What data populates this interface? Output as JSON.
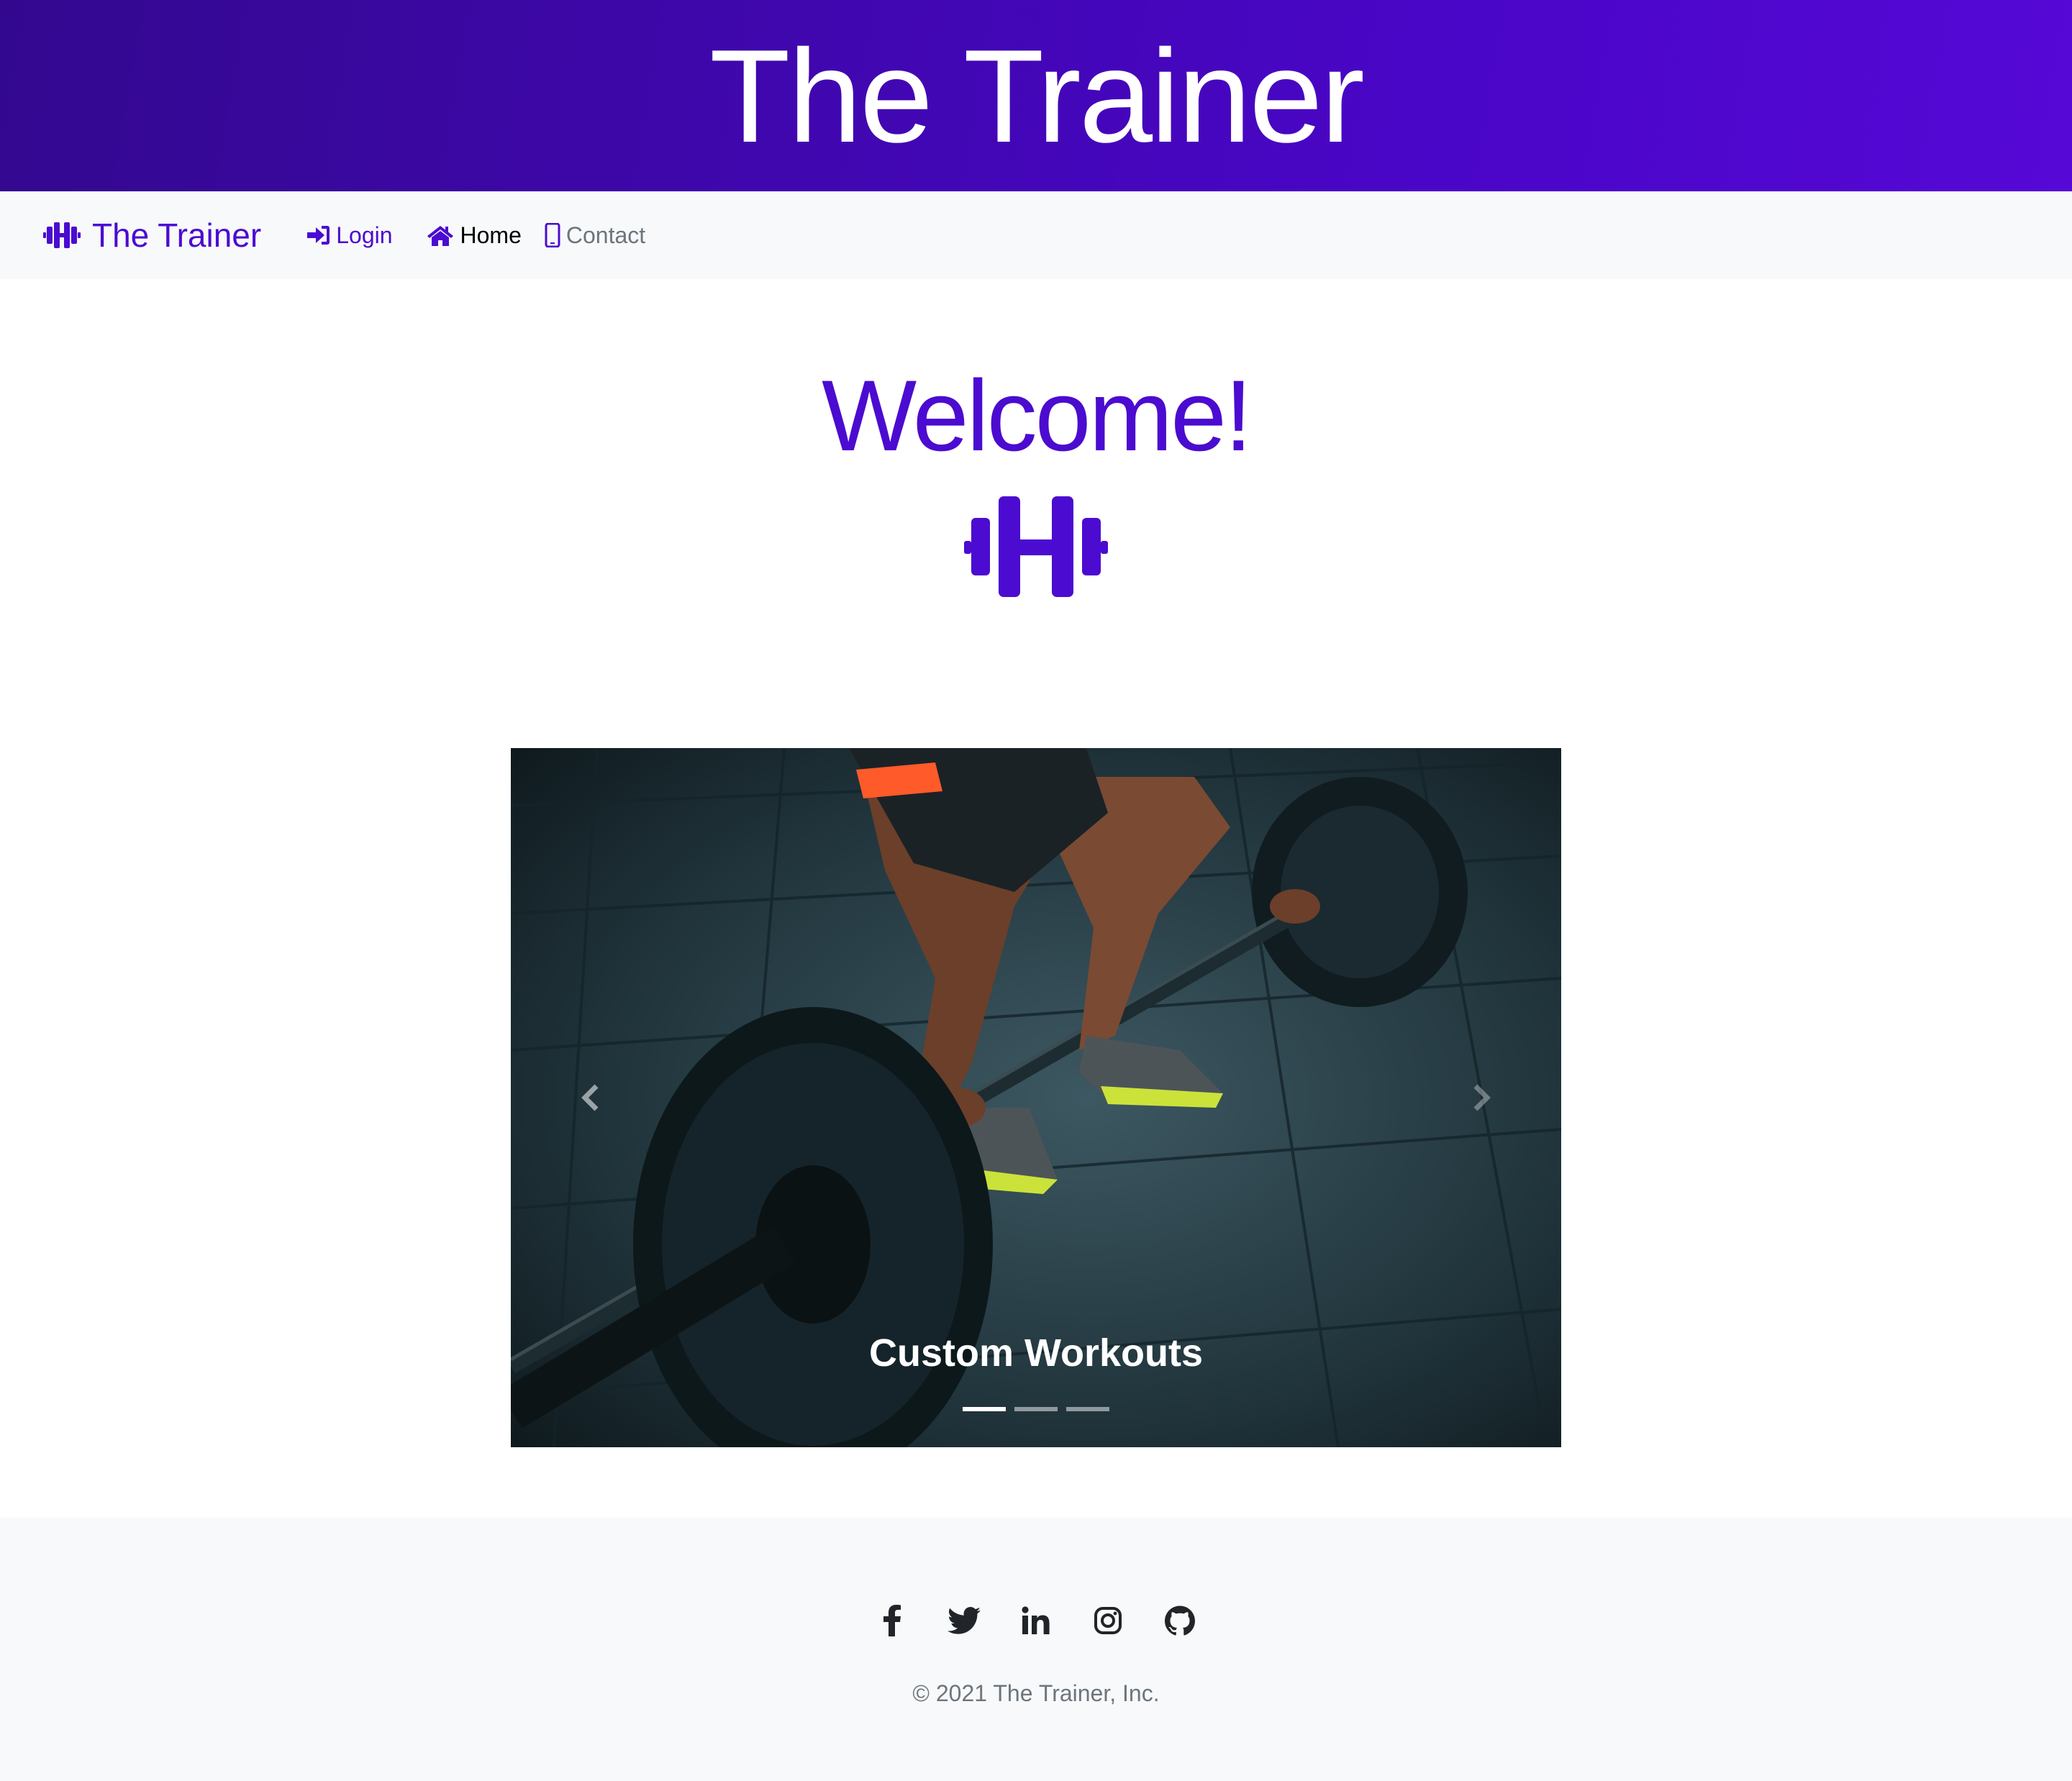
{
  "header": {
    "title": "The Trainer"
  },
  "navbar": {
    "brand": "The Trainer",
    "links": [
      {
        "label": "Login",
        "icon": "sign-in-icon"
      },
      {
        "label": "Home",
        "icon": "home-icon"
      },
      {
        "label": "Contact",
        "icon": "mobile-icon"
      }
    ]
  },
  "main": {
    "welcome": "Welcome!",
    "icon": "dumbbell-icon"
  },
  "carousel": {
    "caption": "Custom Workouts",
    "slide_count": 3,
    "active_index": 0
  },
  "footer": {
    "socials": [
      "facebook-icon",
      "twitter-icon",
      "linkedin-icon",
      "instagram-icon",
      "github-icon"
    ],
    "copyright": "© 2021 The Trainer, Inc."
  },
  "colors": {
    "brand": "#4b0bd0",
    "hero_start": "#33088f",
    "hero_end": "#5608d6",
    "nav_bg": "#f8f9fa",
    "muted": "#6c757d"
  }
}
